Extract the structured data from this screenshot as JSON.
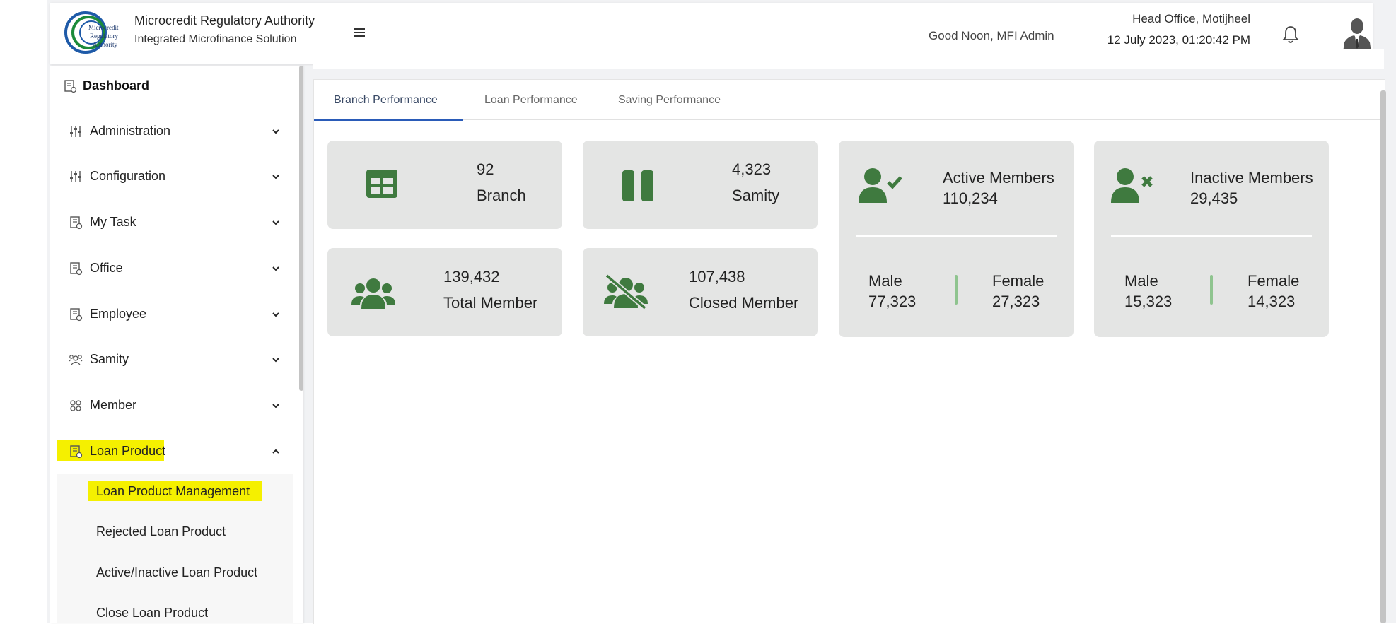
{
  "header": {
    "brand_title": "Microcredit Regulatory Authority",
    "brand_subtitle": "Integrated Microfinance Solution",
    "logo_text": [
      "Microcredit",
      "Regulatory",
      "Authority"
    ],
    "greeting": "Good Noon, MFI Admin",
    "office": "Head Office, Motijheel",
    "datetime": "12 July 2023, 01:20:42 PM",
    "icons": [
      "menu-icon",
      "bell-icon",
      "user-avatar-icon"
    ]
  },
  "sidebar": {
    "dashboard": "Dashboard",
    "items": [
      {
        "label": "Administration",
        "icon": "sliders-icon"
      },
      {
        "label": "Configuration",
        "icon": "sliders-icon"
      },
      {
        "label": "My Task",
        "icon": "document-icon"
      },
      {
        "label": "Office",
        "icon": "document-icon"
      },
      {
        "label": "Employee",
        "icon": "document-icon"
      },
      {
        "label": "Samity",
        "icon": "group-icon"
      },
      {
        "label": "Member",
        "icon": "members-icon"
      },
      {
        "label": "Loan Product",
        "icon": "document-icon",
        "expanded": true,
        "highlighted": true
      }
    ],
    "loan_submenu": [
      {
        "label": "Loan Product Management",
        "highlighted": true
      },
      {
        "label": "Rejected Loan Product"
      },
      {
        "label": "Active/Inactive Loan Product"
      },
      {
        "label": "Close Loan Product"
      }
    ]
  },
  "tabs": [
    {
      "label": "Branch Performance",
      "active": true
    },
    {
      "label": "Loan Performance"
    },
    {
      "label": "Saving Performance"
    }
  ],
  "stats": {
    "branch": {
      "value": "92",
      "label": "Branch"
    },
    "samity": {
      "value": "4,323",
      "label": "Samity"
    },
    "total_member": {
      "value": "139,432",
      "label": "Total Member"
    },
    "closed_member": {
      "value": "107,438",
      "label": "Closed Member"
    },
    "active_members": {
      "title": "Active Members",
      "value": "110,234",
      "male_label": "Male",
      "male": "77,323",
      "female_label": "Female",
      "female": "27,323"
    },
    "inactive_members": {
      "title": "Inactive Members",
      "value": "29,435",
      "male_label": "Male",
      "male": "15,323",
      "female_label": "Female",
      "female": "14,323"
    }
  },
  "colors": {
    "icon_green": "#3f7a3f",
    "card_bg": "#e4e5e4",
    "highlight": "#f5f000",
    "tab_active": "#2a5bb8",
    "divider_green": "#8fc48f"
  }
}
